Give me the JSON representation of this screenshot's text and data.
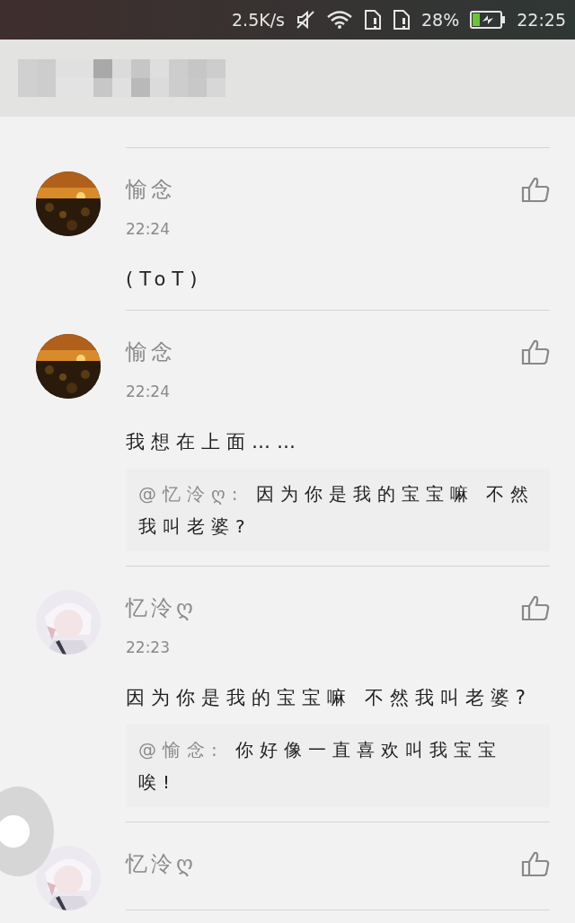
{
  "status_bar": {
    "speed": "2.5K/s",
    "battery": "28%",
    "time": "22:25"
  },
  "comments": [
    {
      "name": "愉念",
      "time": "22:24",
      "text": "(ToT)",
      "liked": false
    },
    {
      "name": "愉念",
      "time": "22:24",
      "text": "我想在上面……",
      "reply": {
        "author": "@忆泠ღ:",
        "text": "因为你是我的宝宝嘛 不然我叫老婆?"
      },
      "liked": false
    },
    {
      "name": "忆泠ღ",
      "time": "22:23",
      "text": "因为你是我的宝宝嘛 不然我叫老婆?",
      "reply": {
        "author": "@愉念:",
        "text": "你好像一直喜欢叫我宝宝唉!"
      },
      "liked": false
    },
    {
      "name": "忆泠ღ",
      "liked": false
    }
  ]
}
